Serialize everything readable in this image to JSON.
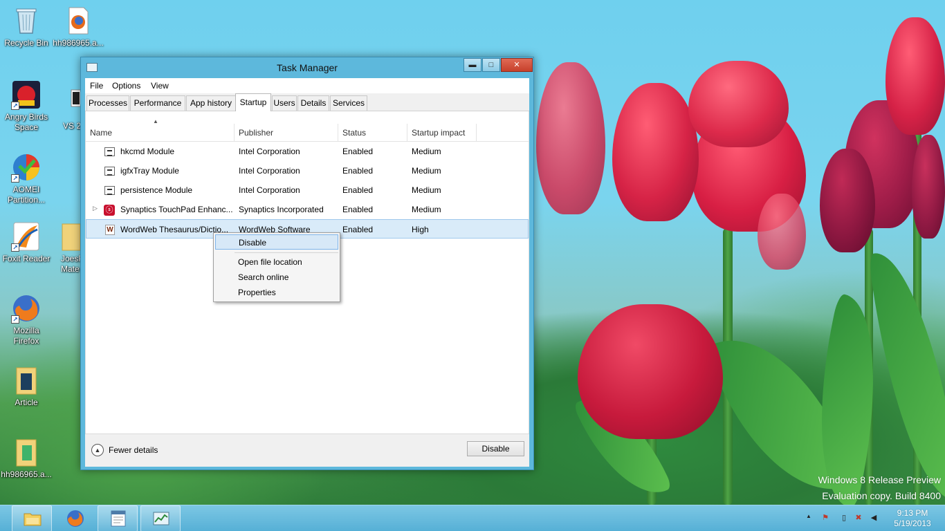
{
  "desktop": {
    "icons": [
      {
        "label": "Recycle Bin"
      },
      {
        "label": "hh986965.a..."
      },
      {
        "label": "Angry Birds Space"
      },
      {
        "label": "VS 2"
      },
      {
        "label": "AOMEI Partition..."
      },
      {
        "label": "Foxit Reader"
      },
      {
        "label": "JoesP Mate"
      },
      {
        "label": "Mozilla Firefox"
      },
      {
        "label": "Article"
      },
      {
        "label": "hh986965.a..."
      }
    ],
    "watermark_line1": "Windows 8 Release Preview",
    "watermark_line2": "Evaluation copy. Build 8400"
  },
  "window": {
    "title": "Task Manager",
    "caption_min": "▬",
    "caption_max": "□",
    "caption_close": "✕"
  },
  "menu": [
    "File",
    "Options",
    "View"
  ],
  "tabs": [
    "Processes",
    "Performance",
    "App history",
    "Startup",
    "Users",
    "Details",
    "Services"
  ],
  "active_tab": "Startup",
  "columns": {
    "name": "Name",
    "publisher": "Publisher",
    "status": "Status",
    "impact": "Startup impact"
  },
  "rows": [
    {
      "name": "hkcmd Module",
      "publisher": "Intel Corporation",
      "status": "Enabled",
      "impact": "Medium"
    },
    {
      "name": "igfxTray Module",
      "publisher": "Intel Corporation",
      "status": "Enabled",
      "impact": "Medium"
    },
    {
      "name": "persistence Module",
      "publisher": "Intel Corporation",
      "status": "Enabled",
      "impact": "Medium"
    },
    {
      "name": "Synaptics TouchPad Enhanc...",
      "publisher": "Synaptics Incorporated",
      "status": "Enabled",
      "impact": "Medium"
    },
    {
      "name": "WordWeb Thesaurus/Dictio...",
      "publisher": "WordWeb Software",
      "status": "Enabled",
      "impact": "High"
    }
  ],
  "context_menu": [
    "Disable",
    "Open file location",
    "Search online",
    "Properties"
  ],
  "footer": {
    "fewer_details": "Fewer details",
    "disable_button": "Disable"
  },
  "taskbar": {
    "time": "9:13 PM",
    "date": "5/19/2013"
  },
  "colors": {
    "accent": "#5db8dc",
    "selection": "#d9ebf9",
    "close": "#c7402b"
  }
}
